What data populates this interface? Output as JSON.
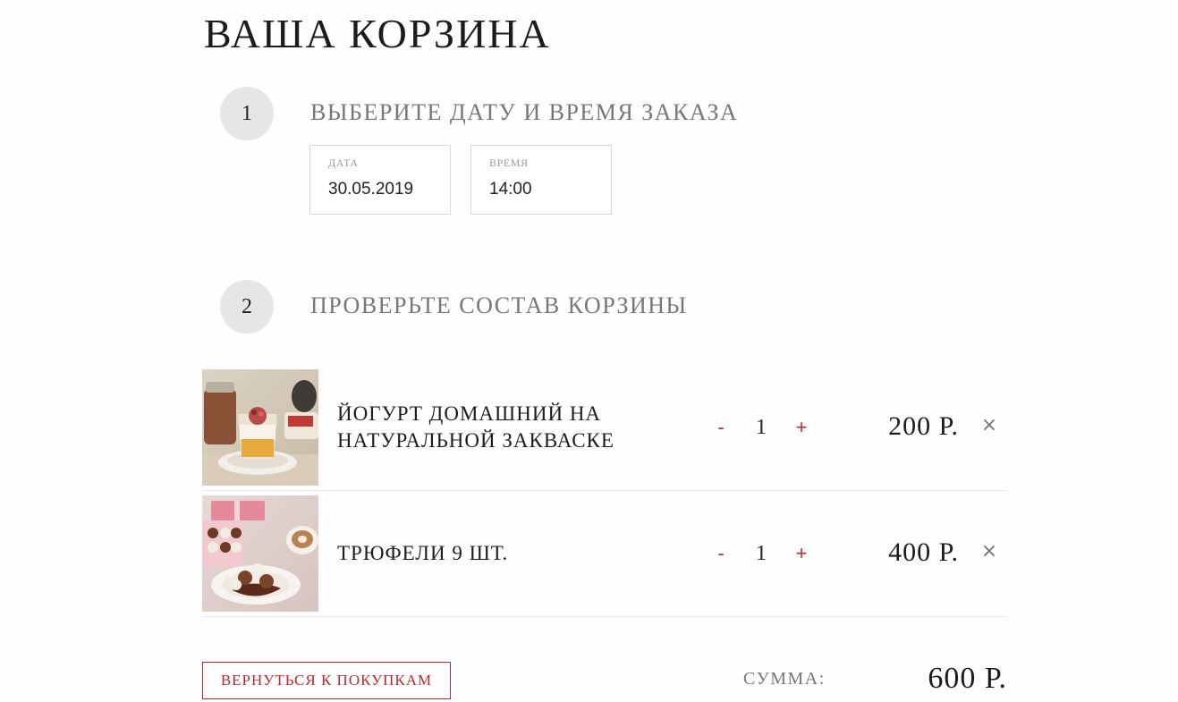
{
  "page": {
    "title": "Ваша корзина"
  },
  "steps": [
    {
      "number": "1",
      "title": "Выберите дату и время заказа"
    },
    {
      "number": "2",
      "title": "Проверьте состав корзины"
    }
  ],
  "order_fields": {
    "date": {
      "label": "Дата",
      "value": "30.05.2019"
    },
    "time": {
      "label": "Время",
      "value": "14:00"
    }
  },
  "cart": {
    "items": [
      {
        "name": "Йогурт домашний на натуральной закваске",
        "qty_minus": "-",
        "quantity": "1",
        "qty_plus": "+",
        "price": "200 Р.",
        "remove": "×"
      },
      {
        "name": "Трюфели 9 шт.",
        "qty_minus": "-",
        "quantity": "1",
        "qty_plus": "+",
        "price": "400 Р.",
        "remove": "×"
      }
    ]
  },
  "footer": {
    "back_label": "Вернуться к покупкам",
    "total_label": "Сумма:",
    "total_value": "600 Р."
  },
  "colors": {
    "accent": "#c0282b",
    "muted_text": "#777777",
    "step_circle": "#e6e6e6",
    "divider": "#e8e8e8"
  },
  "icons": {
    "remove": "close-icon",
    "increase": "plus-icon",
    "decrease": "minus-icon"
  }
}
